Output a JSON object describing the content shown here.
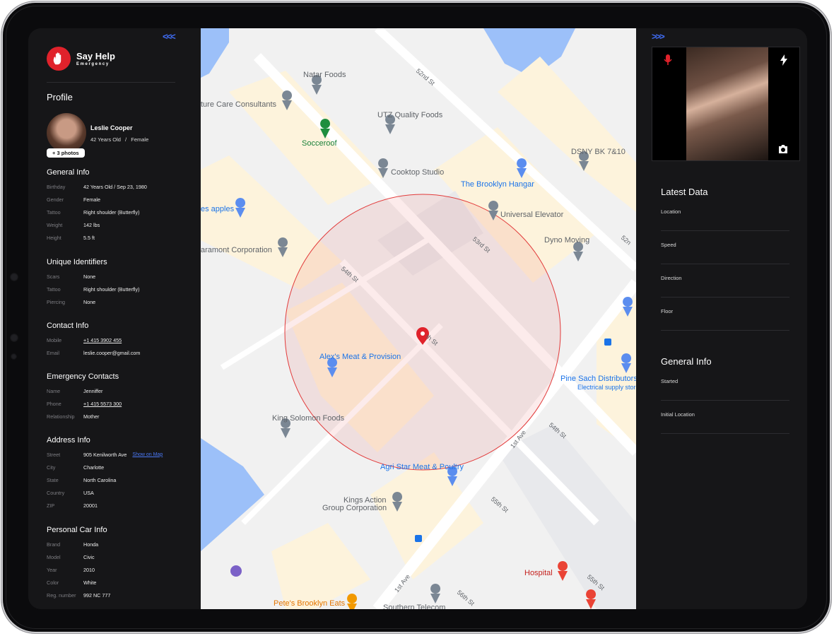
{
  "app": {
    "name": "Say Help",
    "tagline": "Emergency"
  },
  "profile": {
    "title": "Profile",
    "name": "Leslie Cooper",
    "age": "42 Years Old",
    "sep": "/",
    "gender": "Female",
    "photos": "+ 3 photos"
  },
  "general_info": {
    "title": "General Info",
    "rows": [
      {
        "k": "Birthday",
        "v": "42 Years Old  /  Sep 23, 1980"
      },
      {
        "k": "Gender",
        "v": "Female"
      },
      {
        "k": "Tattoo",
        "v": "Right shoulder (Butterfly)"
      },
      {
        "k": "Weight",
        "v": "142 lbs"
      },
      {
        "k": "Height",
        "v": "5.5 ft"
      }
    ]
  },
  "unique_identifiers": {
    "title": "Unique Identifiers",
    "rows": [
      {
        "k": "Scars",
        "v": "None"
      },
      {
        "k": "Tattoo",
        "v": "Right shoulder (Butterfly)"
      },
      {
        "k": "Piercing",
        "v": "None"
      }
    ]
  },
  "contact_info": {
    "title": "Contact Info",
    "rows": [
      {
        "k": "Mobile",
        "v": "+1 415 3902 455"
      },
      {
        "k": "Email",
        "v": "leslie.cooper@gmail.com"
      }
    ]
  },
  "emergency_contacts": {
    "title": "Emergency Contacts",
    "rows": [
      {
        "k": "Name",
        "v": "Jenniffer"
      },
      {
        "k": "Phone",
        "v": "+1 415 5573 300"
      },
      {
        "k": "Relationship",
        "v": "Mother"
      }
    ]
  },
  "address_info": {
    "title": "Address Info",
    "rows": [
      {
        "k": "Street",
        "v": "905 Kenilworth Ave"
      },
      {
        "k": "City",
        "v": "Charlotte"
      },
      {
        "k": "State",
        "v": "North Carolina"
      },
      {
        "k": "Country",
        "v": "USA"
      },
      {
        "k": "ZIP",
        "v": "20001"
      }
    ],
    "show_on_map": "Show on Map"
  },
  "car_info": {
    "title": "Personal Car Info",
    "rows": [
      {
        "k": "Brand",
        "v": "Honda"
      },
      {
        "k": "Model",
        "v": "Civic"
      },
      {
        "k": "Year",
        "v": "2010"
      },
      {
        "k": "Color",
        "v": "White"
      },
      {
        "k": "Reg. number",
        "v": "992 NC 777"
      }
    ]
  },
  "nav": {
    "collapse": "<<<",
    "expand": ">>>"
  },
  "map": {
    "places": {
      "natar": "Natar Foods",
      "future": "ture Care Consultants",
      "utz": "UTZ Quality Foods",
      "socceroof": "Socceroof",
      "dsny": "DSNY BK 7&10",
      "cooktop": "Cooktop Studio",
      "hangar": "The Brooklyn Hangar",
      "apples": "es apples",
      "universal": "Universal Elevator",
      "paramont": "aramont Corporation",
      "dyno": "Dyno Moving",
      "alex": "Alex's Meat & Provision",
      "pine": "Pine Sach Distributors",
      "pine_sub": "Electrical supply stor",
      "king": "King Solomon Foods",
      "agri": "Agri Star Meat & Poultry",
      "kings_action_1": "Kings Action",
      "kings_action_2": "Group Corporation",
      "hospital": "Hospital",
      "petes": "Pete's Brooklyn Eats",
      "southern": "Southern Telecom"
    },
    "streets": {
      "s52a": "52nd St",
      "s52b": "52n",
      "s53": "53rd St",
      "s54a": "54th St",
      "s54b": "th St",
      "s54c": "54th St",
      "ave1a": "1st Ave",
      "ave1b": "1st Ave",
      "s55a": "55th St",
      "s55b": "55th St",
      "s56": "56th St"
    },
    "colors": {
      "radius": "#e23b3b",
      "pin": "#e0222b"
    }
  },
  "latest_data": {
    "title": "Latest Data",
    "items": [
      "Location",
      "Speed",
      "Direction",
      "Floor"
    ]
  },
  "right_general": {
    "title": "General Info",
    "items": [
      "Started",
      "Initial Location"
    ]
  },
  "colors": {
    "accent": "#3f6bf0",
    "brand": "#e0222b",
    "panel": "#161618"
  }
}
